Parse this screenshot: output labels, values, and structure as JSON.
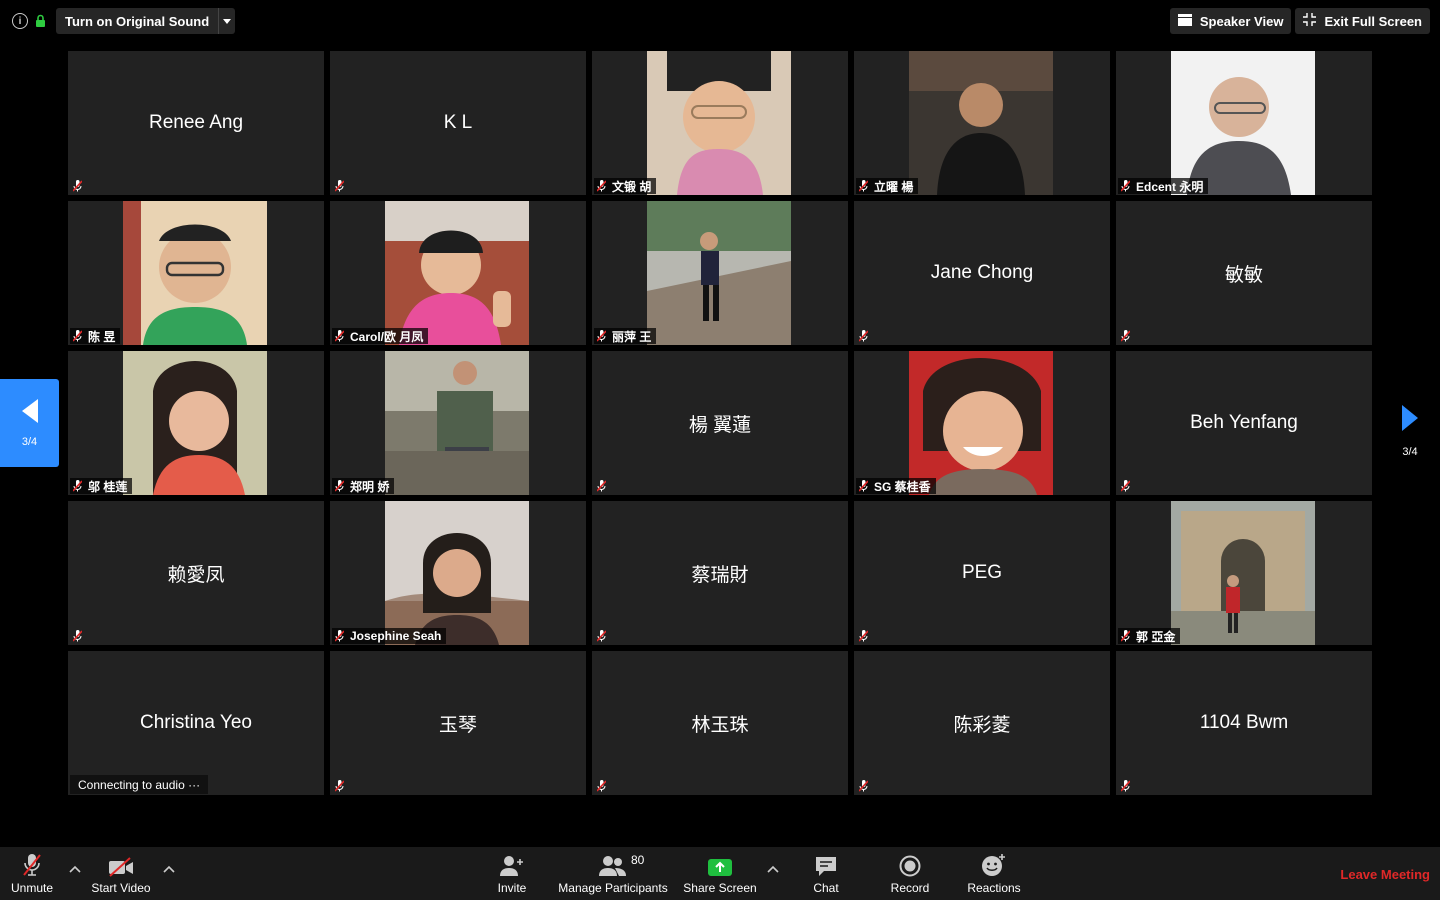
{
  "top": {
    "original_sound_label": "Turn on Original Sound",
    "speaker_view_label": "Speaker View",
    "exit_fullscreen_label": "Exit Full Screen"
  },
  "pager": {
    "left_page": "3/4",
    "right_page": "3/4"
  },
  "tiles": [
    {
      "name": "Renee Ang",
      "display": "name"
    },
    {
      "name": "K L",
      "display": "name"
    },
    {
      "name": "文锻 胡",
      "display": "photo",
      "photo": "woman-pink-scarf"
    },
    {
      "name": "立曜 楊",
      "display": "photo",
      "photo": "man-dark-shirt"
    },
    {
      "name": "Edcent 永明",
      "display": "photo",
      "photo": "bald-man-glasses"
    },
    {
      "name": "陈 昱",
      "display": "photo",
      "photo": "man-glasses-green"
    },
    {
      "name": "Carol/欧 月凤",
      "display": "photo",
      "photo": "woman-peace-sign"
    },
    {
      "name": "丽萍 王",
      "display": "photo",
      "photo": "woman-on-steps"
    },
    {
      "name": "Jane Chong",
      "display": "name"
    },
    {
      "name": "敏敏",
      "display": "name"
    },
    {
      "name": "邬 桂莲",
      "display": "photo",
      "photo": "woman-long-hair"
    },
    {
      "name": "郑明 娇",
      "display": "photo",
      "photo": "woman-seated-outdoor"
    },
    {
      "name": "楊 翼蓮",
      "display": "name"
    },
    {
      "name": "SG 蔡桂香",
      "display": "photo",
      "photo": "woman-smiling-red"
    },
    {
      "name": "Beh Yenfang",
      "display": "name"
    },
    {
      "name": "赖愛凤",
      "display": "name"
    },
    {
      "name": "Josephine Seah",
      "display": "photo",
      "photo": "woman-city-view"
    },
    {
      "name": "蔡瑞財",
      "display": "name"
    },
    {
      "name": "PEG",
      "display": "name"
    },
    {
      "name": "郭 亞金",
      "display": "photo",
      "photo": "woman-stone-gate"
    },
    {
      "name": "Christina Yeo",
      "display": "name",
      "status": "Connecting to audio ···"
    },
    {
      "name": "玉琴",
      "display": "name"
    },
    {
      "name": "林玉珠",
      "display": "name"
    },
    {
      "name": "陈彩菱",
      "display": "name"
    },
    {
      "name": "1104 Bwm",
      "display": "name"
    }
  ],
  "toolbar": {
    "unmute_label": "Unmute",
    "start_video_label": "Start Video",
    "invite_label": "Invite",
    "participants_label": "Manage Participants",
    "participants_count": "80",
    "share_screen_label": "Share Screen",
    "chat_label": "Chat",
    "record_label": "Record",
    "reactions_label": "Reactions",
    "leave_label": "Leave Meeting"
  },
  "colors": {
    "accent": "#2d8cff",
    "share_green": "#1fbf3f",
    "leave_red": "#e02828",
    "tile_bg": "#222222"
  }
}
